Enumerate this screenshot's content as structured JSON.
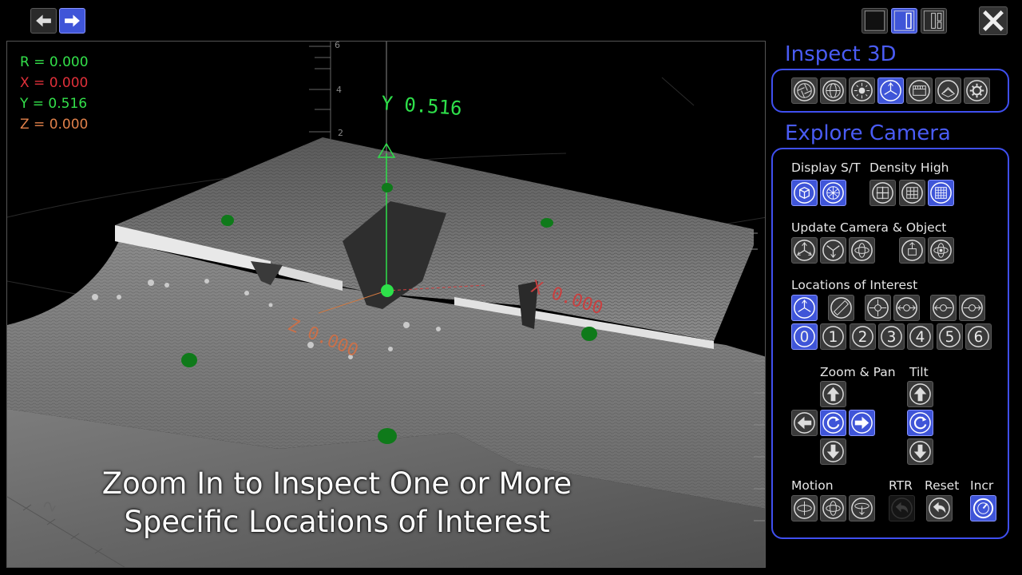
{
  "colors": {
    "accent": "#3f55d8",
    "panel_border": "#3f4ff0",
    "title": "#4a5cf5",
    "loi_marker": "#0f7a1a"
  },
  "top_nav": {
    "back_icon": "arrow-left-icon",
    "forward_icon": "arrow-right-icon"
  },
  "layout_buttons": [
    "layout-single-icon",
    "layout-split-icon",
    "layout-triple-icon"
  ],
  "close_icon": "close-x-icon",
  "readout": {
    "r": "R = 0.000",
    "x": "X = 0.000",
    "y": "Y = 0.516",
    "z": "Z = 0.000"
  },
  "viewport": {
    "axis_y_label": "Y 0.516",
    "axis_x_label": "X 0.000",
    "axis_z_label": "Z 0.000",
    "ticks": [
      "6",
      "4",
      "2"
    ],
    "ruler_numbers": [
      "2",
      "0"
    ]
  },
  "caption": {
    "line1": "Zoom In to Inspect One or More",
    "line2": "Specific Locations of Interest"
  },
  "inspect": {
    "title": "Inspect 3D",
    "tools": [
      "aperture-icon",
      "globe-icon",
      "light-icon",
      "axes-icon",
      "ruler-box-icon",
      "terrain-icon",
      "settings-icon"
    ],
    "selected": 3
  },
  "explore": {
    "title": "Explore Camera",
    "display_label": "Display S/T",
    "density_label": "Density High",
    "update_label": "Update Camera & Object",
    "loi_label": "Locations of Interest",
    "zoom_label": "Zoom & Pan",
    "tilt_label": "Tilt",
    "motion_label": "Motion",
    "rtr_label": "RTR",
    "reset_label": "Reset",
    "incr_label": "Incr",
    "loi_numbers": [
      "0",
      "1",
      "2",
      "3",
      "4",
      "5",
      "6"
    ],
    "loi_selected": 0
  }
}
